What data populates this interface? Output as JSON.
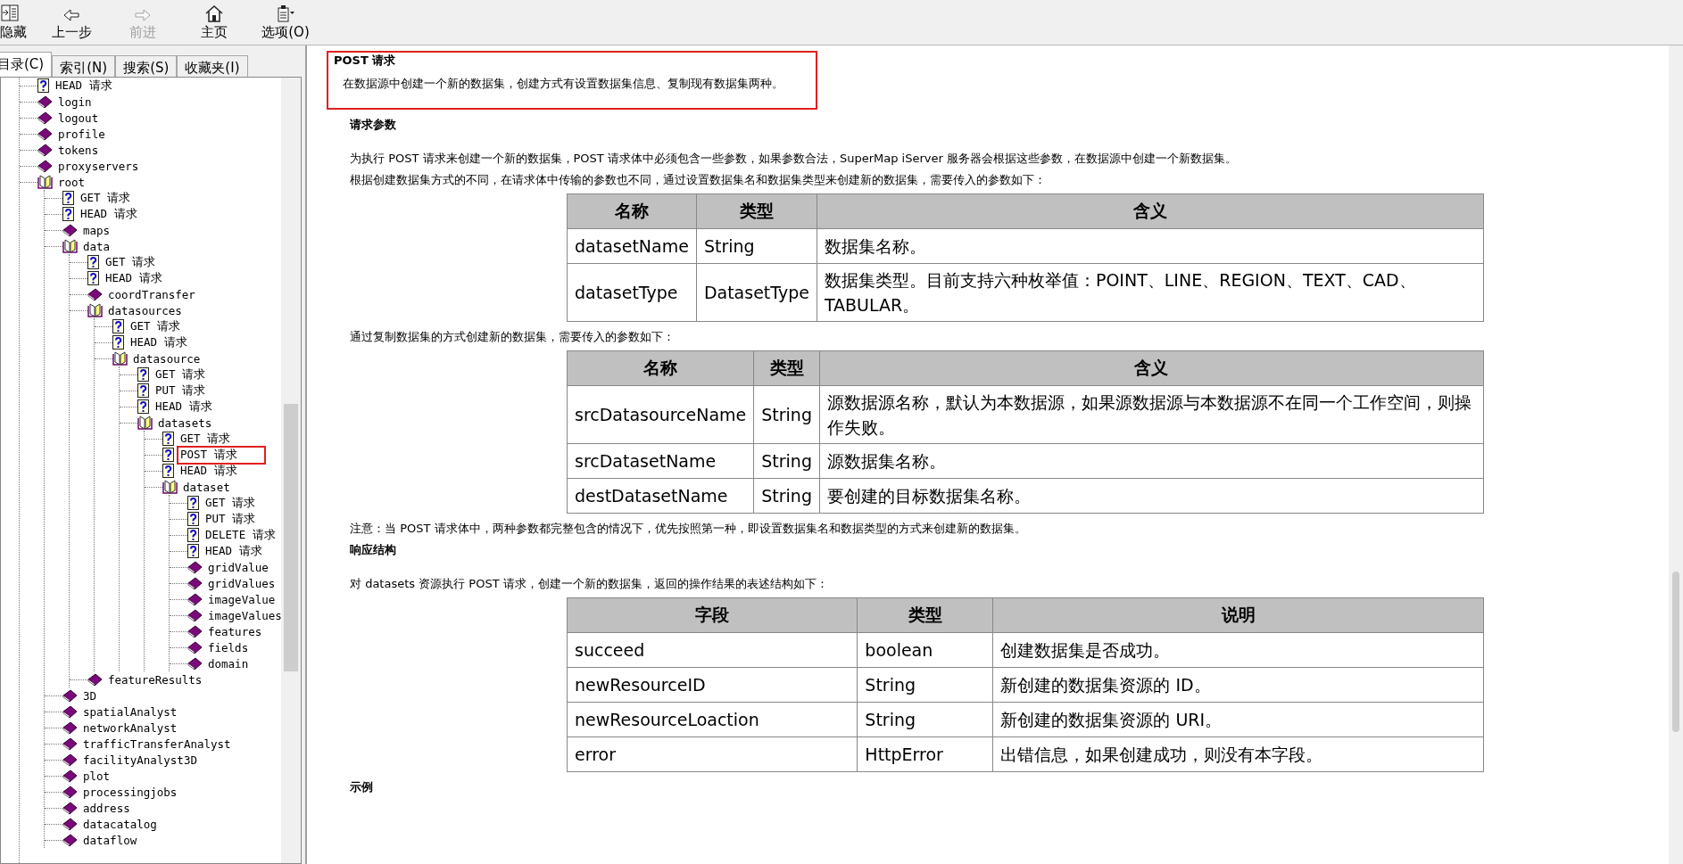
{
  "toolbar": [
    {
      "kind": "hide",
      "label": "隐藏",
      "disabled": false
    },
    {
      "kind": "back",
      "label": "上一步",
      "disabled": false
    },
    {
      "kind": "forward",
      "label": "前进",
      "disabled": true
    },
    {
      "kind": "home",
      "label": "主页",
      "disabled": false
    },
    {
      "kind": "options",
      "label": "选项(O)",
      "disabled": false
    }
  ],
  "tabs": [
    {
      "label": "目录(C)",
      "selected": true
    },
    {
      "label": "索引(N)",
      "selected": false
    },
    {
      "label": "搜索(S)",
      "selected": false
    },
    {
      "label": "收藏夹(I)",
      "selected": false
    }
  ],
  "tree": [
    {
      "kind": "page",
      "label": "HEAD 请求",
      "selected": false
    },
    {
      "kind": "book",
      "label": "login",
      "selected": false
    },
    {
      "kind": "book",
      "label": "logout",
      "selected": false
    },
    {
      "kind": "book",
      "label": "profile",
      "selected": false
    },
    {
      "kind": "book",
      "label": "tokens",
      "selected": false
    },
    {
      "kind": "book",
      "label": "proxyservers",
      "selected": false
    },
    {
      "kind": "open-book",
      "label": "root",
      "selected": false,
      "children": [
        {
          "kind": "page",
          "label": "GET 请求",
          "selected": false
        },
        {
          "kind": "page",
          "label": "HEAD 请求",
          "selected": false
        },
        {
          "kind": "book",
          "label": "maps",
          "selected": false
        },
        {
          "kind": "open-book",
          "label": "data",
          "selected": false,
          "children": [
            {
              "kind": "page",
              "label": "GET 请求",
              "selected": false
            },
            {
              "kind": "page",
              "label": "HEAD 请求",
              "selected": false
            },
            {
              "kind": "book",
              "label": "coordTransfer",
              "selected": false
            },
            {
              "kind": "open-book",
              "label": "datasources",
              "selected": false,
              "children": [
                {
                  "kind": "page",
                  "label": "GET 请求",
                  "selected": false
                },
                {
                  "kind": "page",
                  "label": "HEAD 请求",
                  "selected": false
                },
                {
                  "kind": "open-book",
                  "label": "datasource",
                  "selected": false,
                  "children": [
                    {
                      "kind": "page",
                      "label": "GET 请求",
                      "selected": false
                    },
                    {
                      "kind": "page",
                      "label": "PUT 请求",
                      "selected": false
                    },
                    {
                      "kind": "page",
                      "label": "HEAD 请求",
                      "selected": false
                    },
                    {
                      "kind": "open-book",
                      "label": "datasets",
                      "selected": false,
                      "children": [
                        {
                          "kind": "page",
                          "label": "GET 请求",
                          "selected": false
                        },
                        {
                          "kind": "page",
                          "label": "POST 请求",
                          "selected": true
                        },
                        {
                          "kind": "page",
                          "label": "HEAD 请求",
                          "selected": false
                        },
                        {
                          "kind": "open-book",
                          "label": "dataset",
                          "selected": false,
                          "children": [
                            {
                              "kind": "page",
                              "label": "GET 请求",
                              "selected": false
                            },
                            {
                              "kind": "page",
                              "label": "PUT 请求",
                              "selected": false
                            },
                            {
                              "kind": "page",
                              "label": "DELETE 请求",
                              "selected": false
                            },
                            {
                              "kind": "page",
                              "label": "HEAD 请求",
                              "selected": false
                            },
                            {
                              "kind": "book",
                              "label": "gridValue",
                              "selected": false
                            },
                            {
                              "kind": "book",
                              "label": "gridValues",
                              "selected": false
                            },
                            {
                              "kind": "book",
                              "label": "imageValue",
                              "selected": false
                            },
                            {
                              "kind": "book",
                              "label": "imageValues",
                              "selected": false
                            },
                            {
                              "kind": "book",
                              "label": "features",
                              "selected": false
                            },
                            {
                              "kind": "book",
                              "label": "fields",
                              "selected": false
                            },
                            {
                              "kind": "book",
                              "label": "domain",
                              "selected": false
                            }
                          ]
                        }
                      ]
                    }
                  ]
                }
              ]
            },
            {
              "kind": "book",
              "label": "featureResults",
              "selected": false
            }
          ]
        },
        {
          "kind": "book",
          "label": "3D",
          "selected": false
        },
        {
          "kind": "book",
          "label": "spatialAnalyst",
          "selected": false
        },
        {
          "kind": "book",
          "label": "networkAnalyst",
          "selected": false
        },
        {
          "kind": "book",
          "label": "trafficTransferAnalyst",
          "selected": false
        },
        {
          "kind": "book",
          "label": "facilityAnalyst3D",
          "selected": false
        },
        {
          "kind": "book",
          "label": "plot",
          "selected": false
        },
        {
          "kind": "book",
          "label": "processingjobs",
          "selected": false
        },
        {
          "kind": "book",
          "label": "address",
          "selected": false
        },
        {
          "kind": "book",
          "label": "datacatalog",
          "selected": false
        },
        {
          "kind": "book",
          "label": "dataflow",
          "selected": false
        }
      ]
    }
  ],
  "topic": {
    "title": "POST 请求",
    "description": "在数据源中创建一个新的数据集，创建方式有设置数据集信息、复制现有数据集两种。",
    "highlighted": true
  },
  "sections": [
    {
      "heading": "请求参数",
      "blocks": [
        {
          "kind": "paragraph",
          "text": "为执行 POST 请求来创建一个新的数据集，POST 请求体中必须包含一些参数，如果参数合法，SuperMap iServer 服务器会根据这些参数，在数据源中创建一个新数据集。"
        },
        {
          "kind": "paragraph",
          "text": "根据创建数据集方式的不同，在请求体中传输的参数也不同，通过设置数据集名和数据集类型来创建新的数据集，需要传入的参数如下："
        },
        {
          "kind": "table",
          "columns": [
            "名称",
            "类型",
            "含义"
          ],
          "rows": [
            [
              "datasetName",
              "String",
              "数据集名称。"
            ],
            [
              "datasetType",
              "DatasetType",
              "数据集类型。目前支持六种枚举值：POINT、LINE、REGION、TEXT、CAD、TABULAR。"
            ]
          ]
        },
        {
          "kind": "paragraph",
          "text": "通过复制数据集的方式创建新的数据集，需要传入的参数如下："
        },
        {
          "kind": "table",
          "columns": [
            "名称",
            "类型",
            "含义"
          ],
          "rows": [
            [
              "srcDatasourceName",
              "String",
              "源数据源名称，默认为本数据源，如果源数据源与本数据源不在同一个工作空间，则操作失败。"
            ],
            [
              "srcDatasetName",
              "String",
              "源数据集名称。"
            ],
            [
              "destDatasetName",
              "String",
              "要创建的目标数据集名称。"
            ]
          ]
        },
        {
          "kind": "paragraph",
          "text": "注意：当 POST 请求体中，两种参数都完整包含的情况下，优先按照第一种，即设置数据集名和数据类型的方式来创建新的数据集。"
        }
      ]
    },
    {
      "heading": "响应结构",
      "blocks": [
        {
          "kind": "paragraph",
          "text": "对 datasets 资源执行 POST 请求，创建一个新的数据集，返回的操作结果的表述结构如下："
        },
        {
          "kind": "table",
          "columns": [
            "字段",
            "类型",
            "说明"
          ],
          "rows": [
            [
              "succeed",
              "boolean",
              "创建数据集是否成功。"
            ],
            [
              "newResourceID",
              "String",
              "新创建的数据集资源的 ID。"
            ],
            [
              "newResourceLoaction",
              "String",
              "新创建的数据集资源的 URI。"
            ],
            [
              "error",
              "HttpError",
              "出错信息，如果创建成功，则没有本字段。"
            ]
          ]
        }
      ]
    },
    {
      "heading": "示例"
    }
  ]
}
